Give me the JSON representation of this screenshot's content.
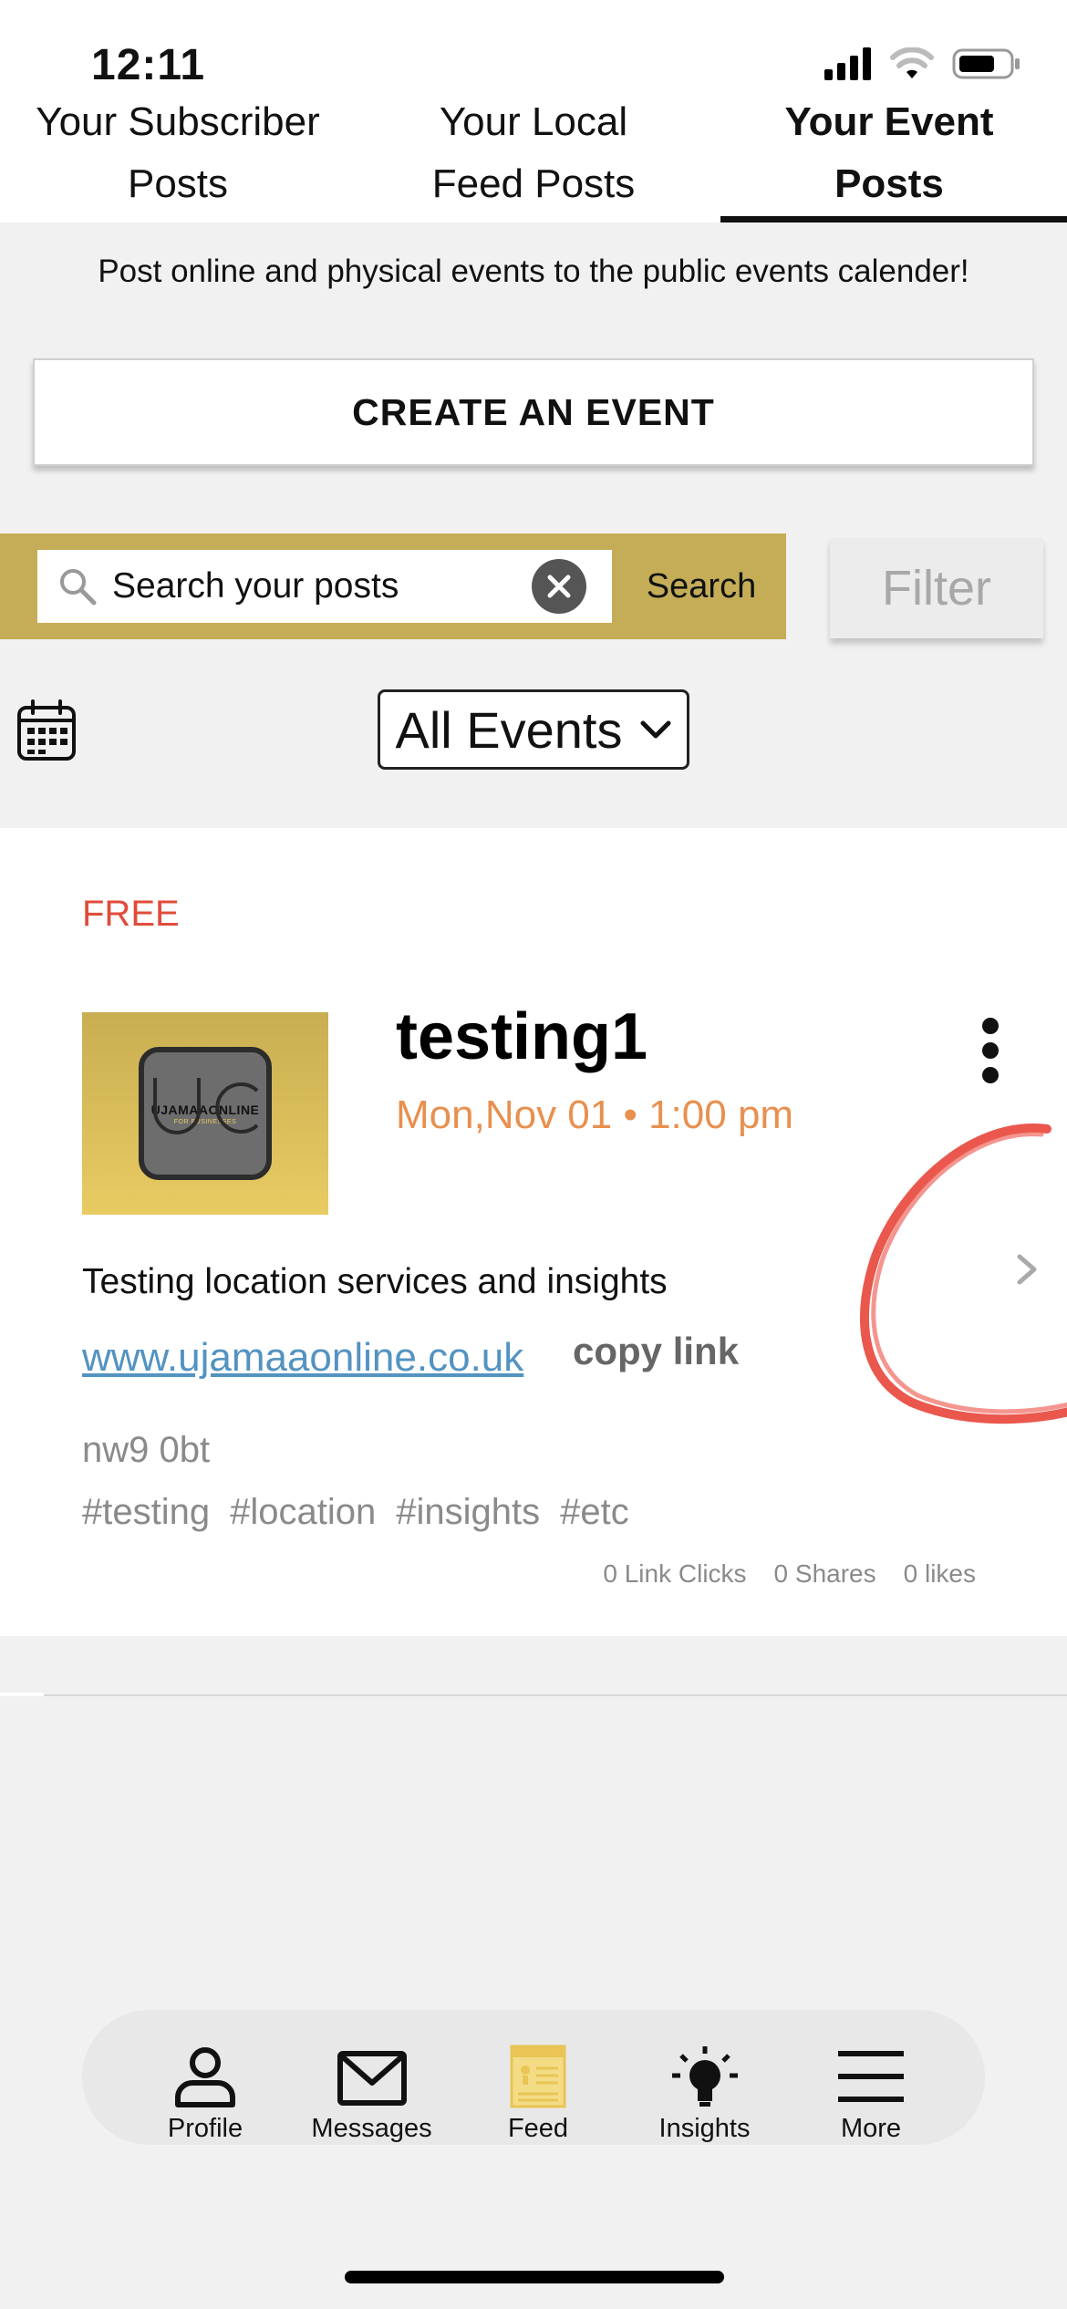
{
  "status_bar": {
    "time": "12:11"
  },
  "tabs": [
    {
      "line1": "Your Subscriber",
      "line2": "Posts",
      "active": false
    },
    {
      "line1": "Your Local",
      "line2": "Feed Posts",
      "active": false
    },
    {
      "line1": "Your Event",
      "line2": "Posts",
      "active": true
    }
  ],
  "info_text": "Post online and physical events to the public events calender!",
  "create_button": "CREATE AN EVENT",
  "search": {
    "value": "",
    "placeholder": "Search your posts",
    "button": "Search"
  },
  "filter_button": "Filter",
  "event_filter": {
    "selected": "All Events"
  },
  "event": {
    "price": "FREE",
    "title": "testing1",
    "date": "Mon,Nov 01 • 1:00 pm",
    "logo_text": "UJAMAAONLINE",
    "logo_subtext": "FOR BUSINESSES",
    "description": "Testing location services and insights",
    "link": "www.ujamaaonline.co.uk",
    "copy_link": "copy link",
    "location": "nw9 0bt",
    "tags": [
      "#testing",
      "#location",
      "#insights",
      "#etc"
    ],
    "stats": {
      "link_clicks": "0 Link Clicks",
      "shares": "0 Shares",
      "likes": "0 likes"
    }
  },
  "bottom_nav": [
    {
      "label": "Profile",
      "icon": "person-icon"
    },
    {
      "label": "Messages",
      "icon": "envelope-icon"
    },
    {
      "label": "Feed",
      "icon": "feed-icon"
    },
    {
      "label": "Insights",
      "icon": "lightbulb-icon"
    },
    {
      "label": "More",
      "icon": "hamburger-icon"
    }
  ],
  "colors": {
    "accent_gold": "#c4ad56",
    "price_red": "#e04c3b",
    "date_orange": "#e8904f",
    "link_blue": "#5393c1",
    "annotation_red": "#e8453a"
  }
}
